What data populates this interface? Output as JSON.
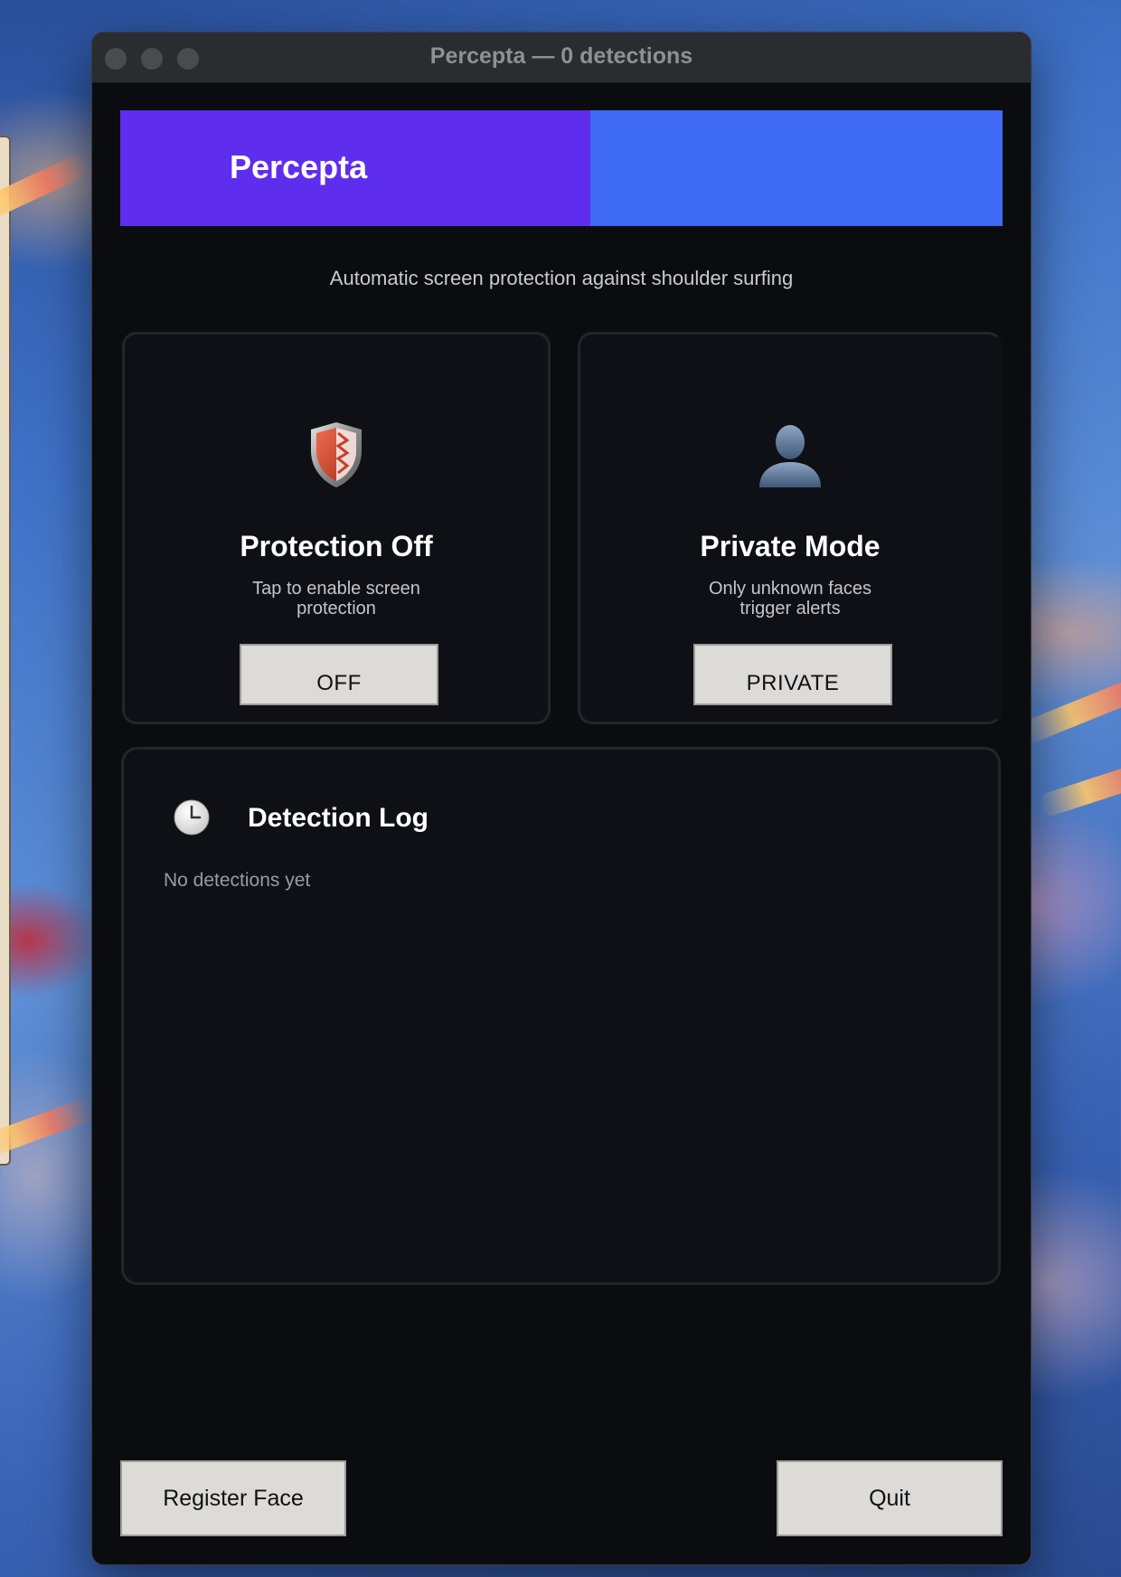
{
  "window": {
    "title": "Percepta — 0 detections"
  },
  "banner": {
    "title": "Percepta",
    "colors": {
      "left": "#5f2ded",
      "right": "#3e6af4"
    }
  },
  "subtitle": "Automatic screen protection against shoulder surfing",
  "cards": {
    "protection": {
      "icon": "shield-icon",
      "title": "Protection Off",
      "description": "Tap to enable screen\nprotection",
      "button_label": "OFF"
    },
    "mode": {
      "icon": "user-silhouette-icon",
      "title": "Private Mode",
      "description": "Only unknown faces\ntrigger alerts",
      "button_label": "PRIVATE"
    }
  },
  "log": {
    "icon": "clock-icon",
    "title": "Detection Log",
    "empty_message": "No detections yet"
  },
  "footer": {
    "register_label": "Register Face",
    "quit_label": "Quit"
  }
}
